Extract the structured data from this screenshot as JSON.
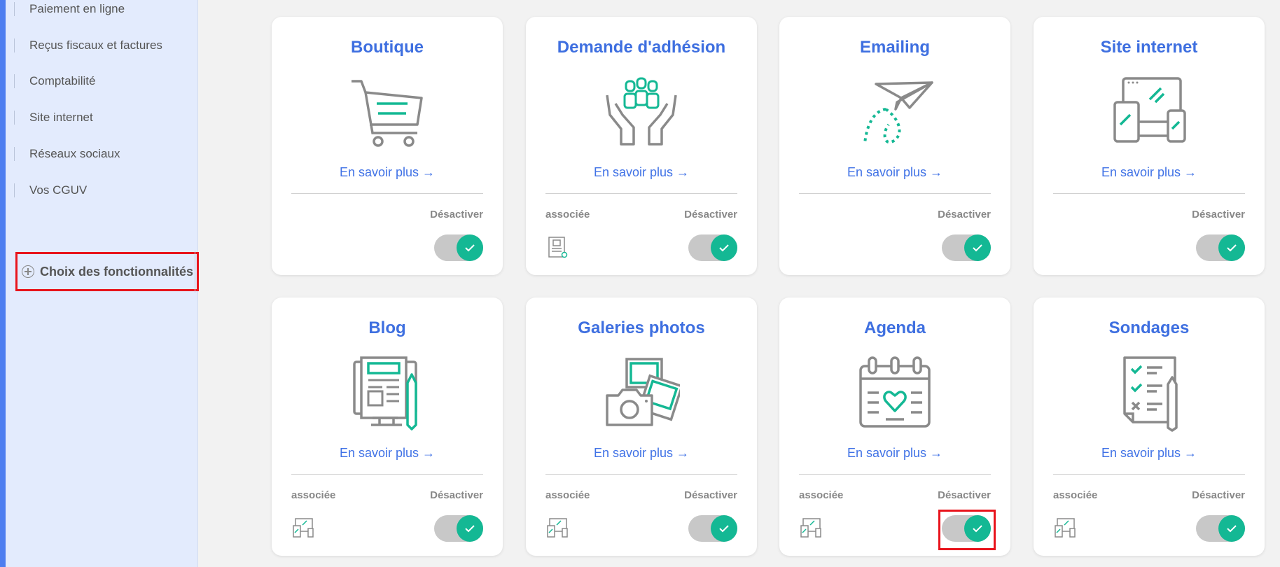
{
  "sidebar": {
    "items": [
      {
        "label": "Paiement en ligne"
      },
      {
        "label": "Reçus fiscaux et factures"
      },
      {
        "label": "Comptabilité"
      },
      {
        "label": "Site internet"
      },
      {
        "label": "Réseaux sociaux"
      },
      {
        "label": "Vos CGUV"
      }
    ],
    "choice_label": "Choix des fonctionnalités"
  },
  "cards": [
    {
      "title": "Boutique",
      "more": "En savoir plus →",
      "deactivate": "Désactiver",
      "enabled": true
    },
    {
      "title": "Demande d'adhésion",
      "more": "En savoir plus →",
      "associated": "associée",
      "deactivate": "Désactiver",
      "enabled": true
    },
    {
      "title": "Emailing",
      "more": "En savoir plus →",
      "deactivate": "Désactiver",
      "enabled": true
    },
    {
      "title": "Site internet",
      "more": "En savoir plus →",
      "deactivate": "Désactiver",
      "enabled": true
    },
    {
      "title": "Blog",
      "more": "En savoir plus →",
      "associated": "associée",
      "deactivate": "Désactiver",
      "enabled": true
    },
    {
      "title": "Galeries photos",
      "more": "En savoir plus →",
      "associated": "associée",
      "deactivate": "Désactiver",
      "enabled": true
    },
    {
      "title": "Agenda",
      "more": "En savoir plus →",
      "associated": "associée",
      "deactivate": "Désactiver",
      "enabled": true
    },
    {
      "title": "Sondages",
      "more": "En savoir plus →",
      "associated": "associée",
      "deactivate": "Désactiver",
      "enabled": true
    }
  ],
  "colors": {
    "accent": "#3e6fe0",
    "toggle_on": "#14b894",
    "highlight": "#e8141c",
    "icon_gray": "#8a8a8a",
    "icon_teal": "#14b894"
  }
}
